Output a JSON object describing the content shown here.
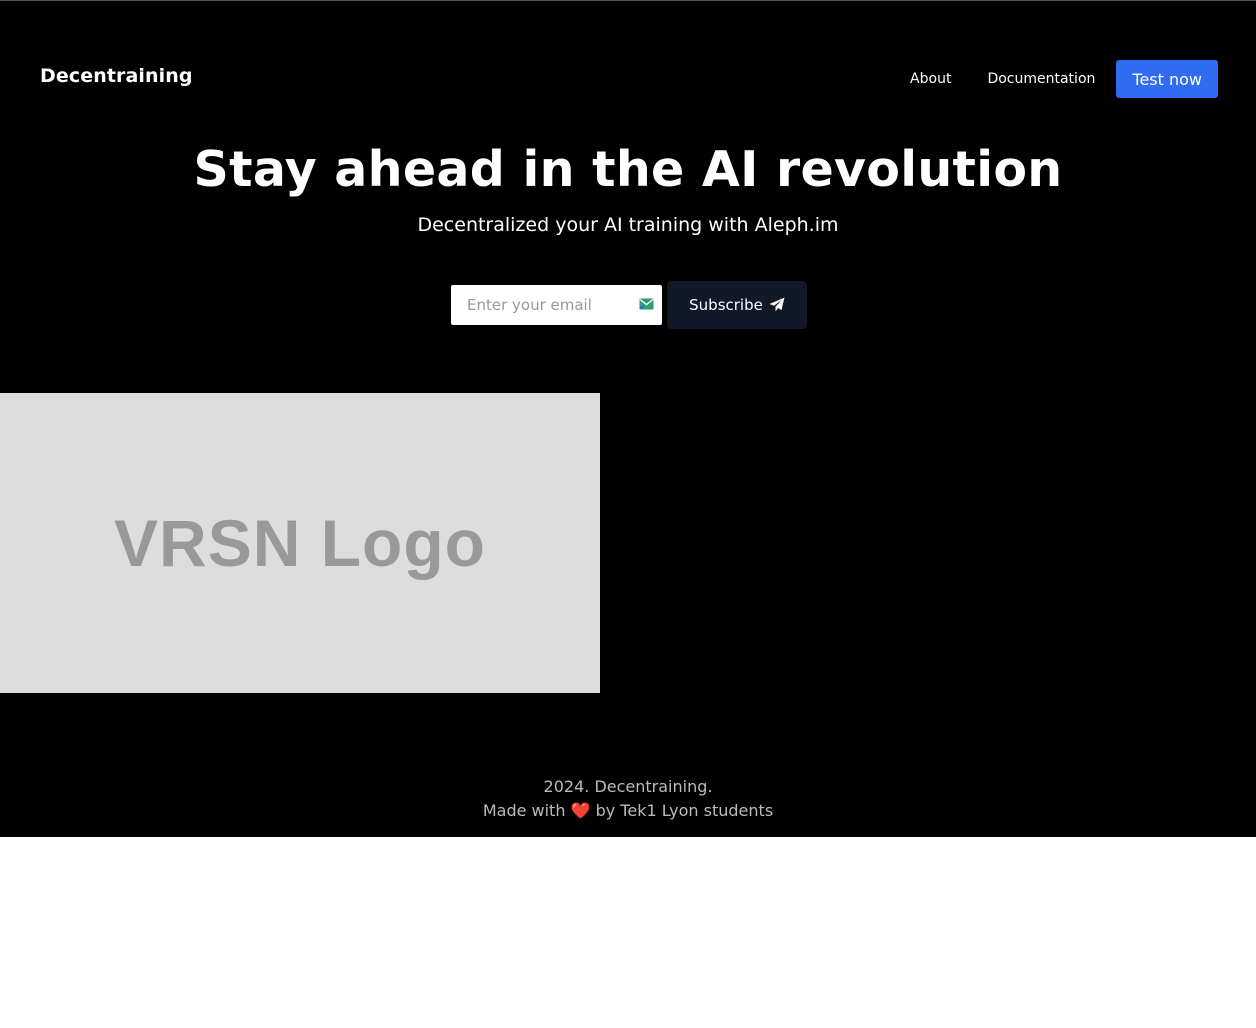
{
  "header": {
    "brand": "Decentraining",
    "nav": [
      {
        "label": "About"
      },
      {
        "label": "Documentation"
      }
    ],
    "cta_label": "Test now"
  },
  "hero": {
    "title": "Stay ahead in the AI revolution",
    "subtitle": "Decentralized your AI training with Aleph.im"
  },
  "subscribe_form": {
    "email_placeholder": "Enter your email",
    "button_label": "Subscribe",
    "email_icon": "envelope-icon",
    "button_icon": "paper-plane-icon"
  },
  "logo_placeholder": {
    "text": "VRSN Logo"
  },
  "footer": {
    "line1": "2024. Decentraining.",
    "line2_prefix": "Made with",
    "heart": "❤️",
    "line2_suffix": "by Tek1 Lyon students"
  },
  "colors": {
    "background": "#000000",
    "accent": "#2f6cf0",
    "subscribe_bg": "#111827",
    "logo_bg": "#dddddd"
  }
}
